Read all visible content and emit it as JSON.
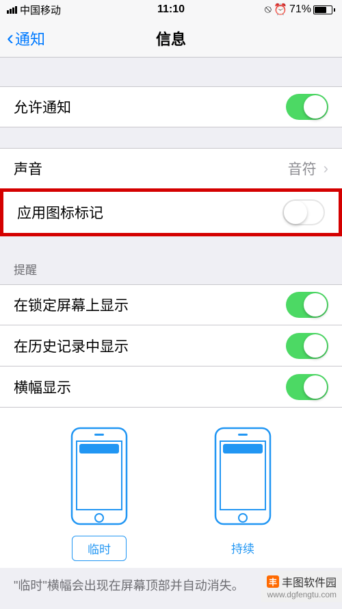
{
  "status": {
    "carrier": "中国移动",
    "time": "11:10",
    "battery_pct": "71%",
    "rotation_lock_icon": "⊕",
    "alarm_icon": "⏰"
  },
  "nav": {
    "back_label": "通知",
    "title": "信息"
  },
  "allow_notifications": {
    "label": "允许通知",
    "on": true
  },
  "sound": {
    "label": "声音",
    "value": "音符"
  },
  "badge": {
    "label": "应用图标标记",
    "on": false
  },
  "alerts_header": "提醒",
  "lock_screen": {
    "label": "在锁定屏幕上显示",
    "on": true
  },
  "history": {
    "label": "在历史记录中显示",
    "on": true
  },
  "banner": {
    "label": "横幅显示",
    "on": true
  },
  "banner_styles": {
    "temporary": "临时",
    "persistent": "持续"
  },
  "footer": "\"临时\"横幅会出现在屏幕顶部并自动消失。",
  "watermark": {
    "name": "丰图软件园",
    "url": "www.dgfengtu.com"
  }
}
